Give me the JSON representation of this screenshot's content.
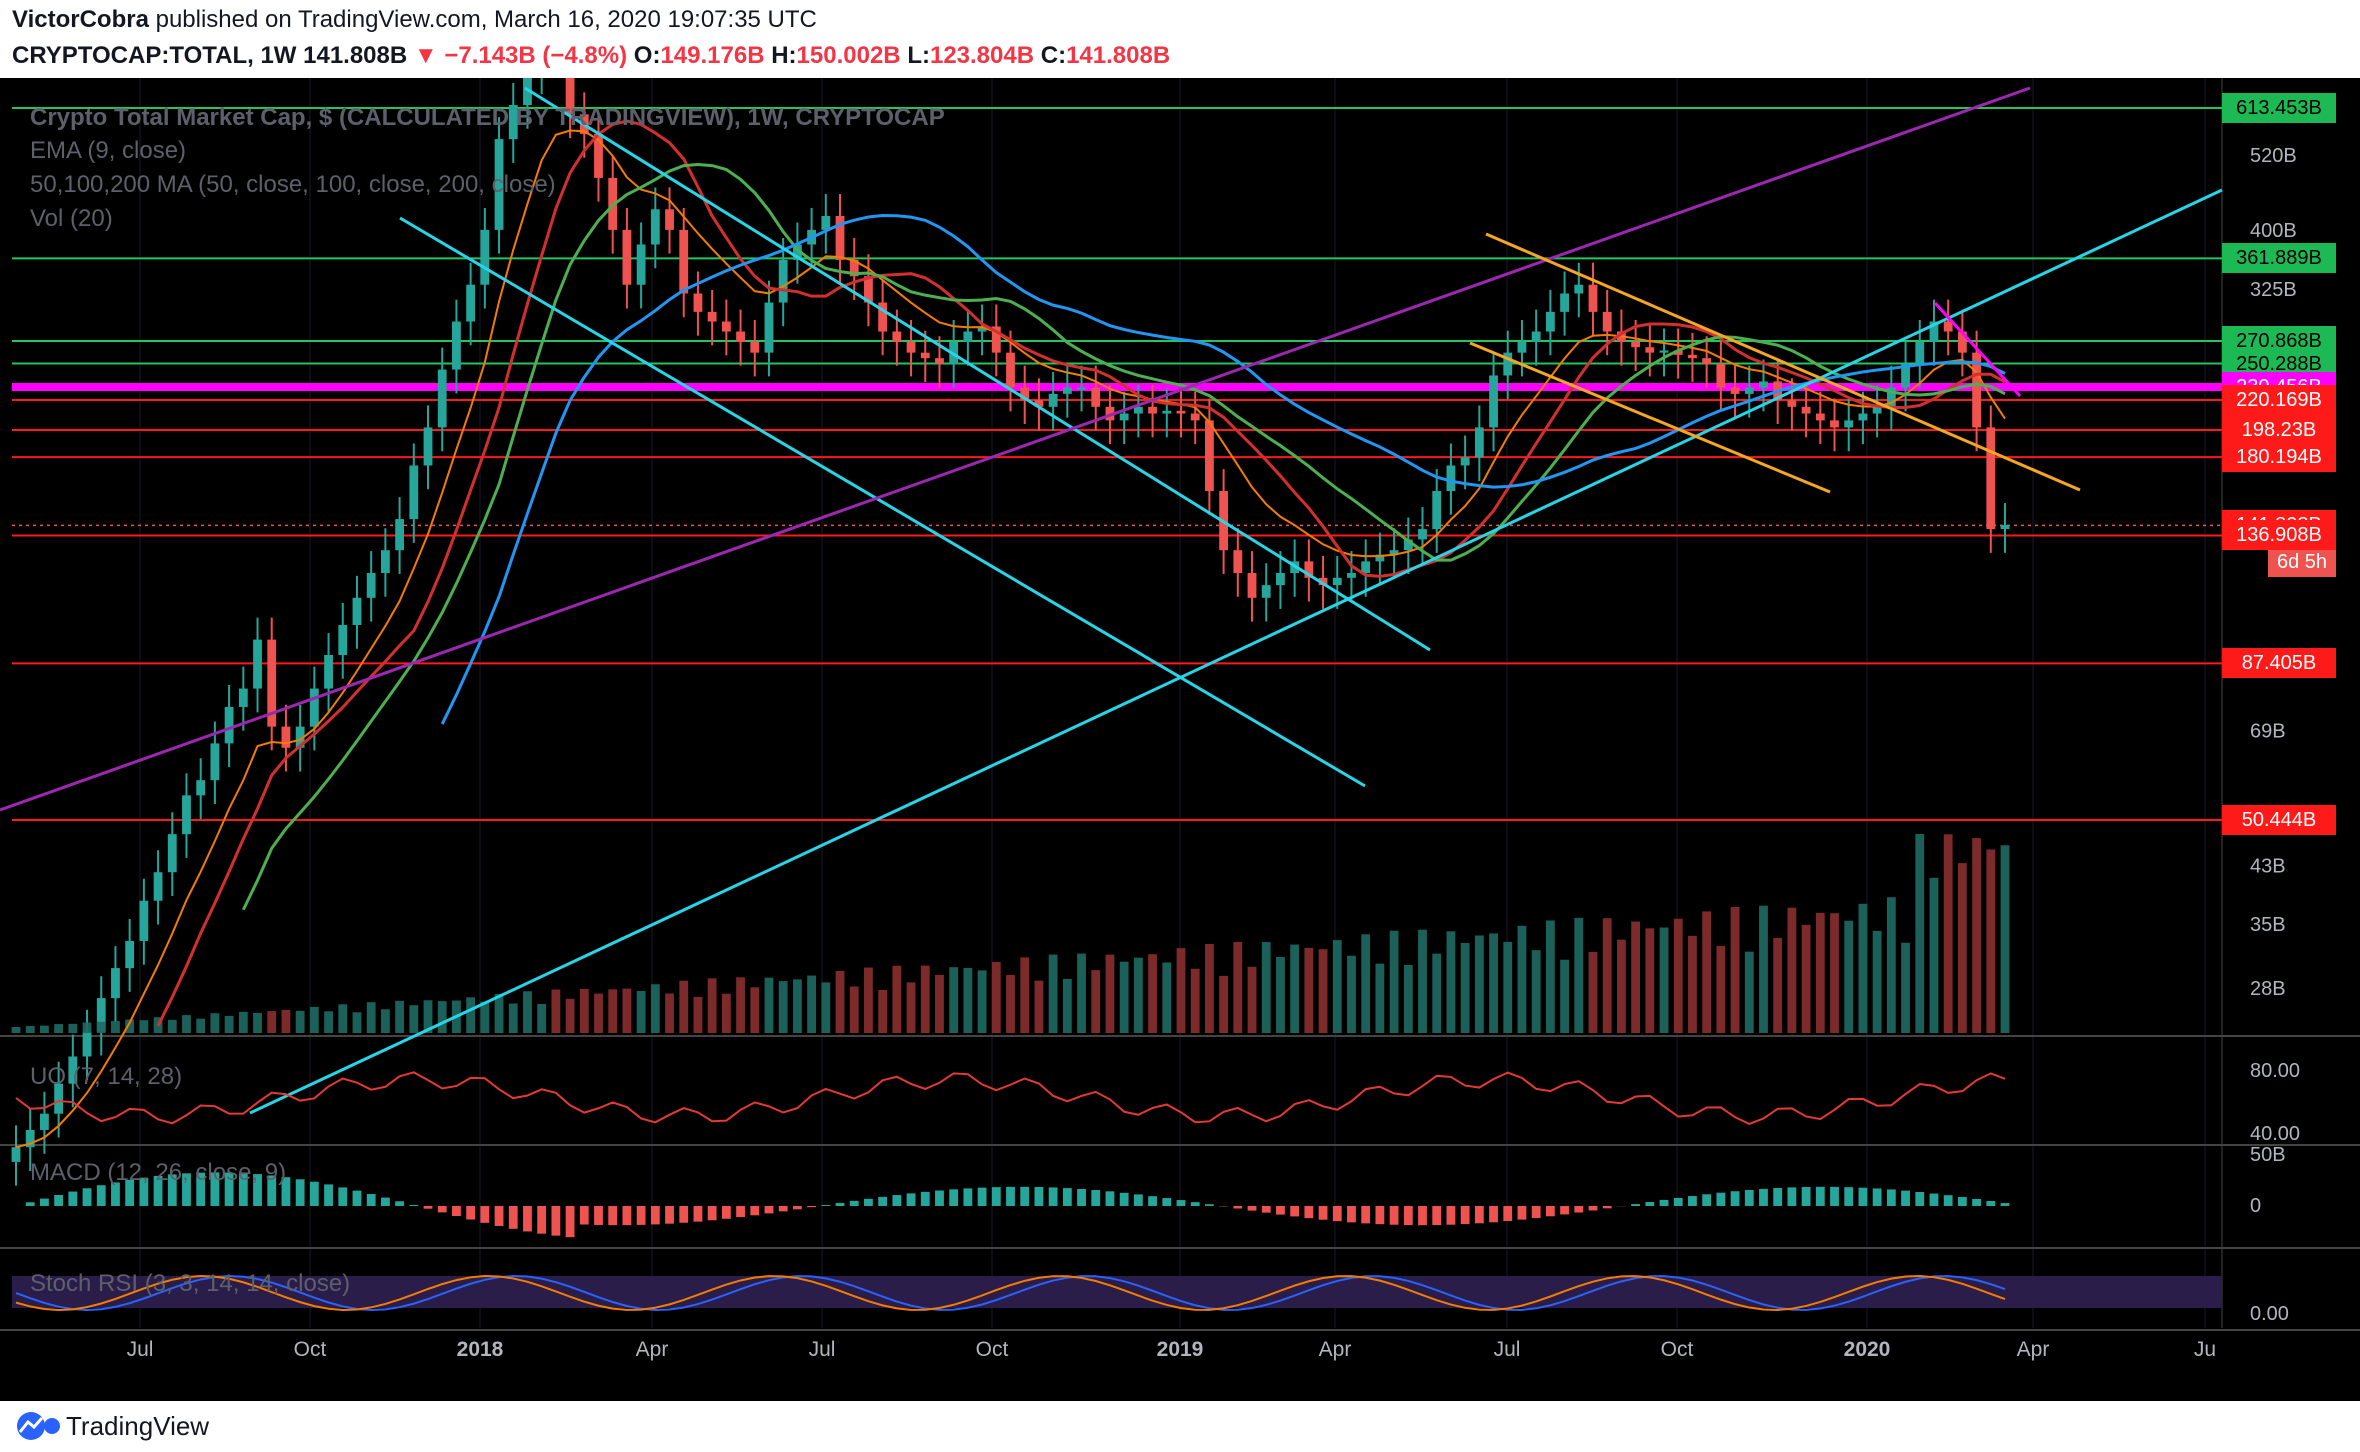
{
  "header": {
    "author": "VictorCobra",
    "published": "published on TradingView.com, March 16, 2020 19:07:35 UTC",
    "symbol": "CRYPTOCAP:TOTAL, 1W",
    "last": "141.808B",
    "change": "−7.143B (−4.8%)",
    "o_label": "O:",
    "o_value": "149.176B",
    "h_label": "H:",
    "h_value": "150.002B",
    "l_label": "L:",
    "l_value": "123.804B",
    "c_label": "C:",
    "c_value": "141.808B"
  },
  "legend": {
    "title": "Crypto Total Market Cap, $ (CALCULATED BY TRADINGVIEW), 1W, CRYPTOCAP",
    "ema": "EMA (9, close)",
    "ma": "50,100,200 MA (50, close, 100, close, 200, close)",
    "vol": "Vol (20)",
    "uo": "UO (7, 14, 28)",
    "macd": "MACD (12, 26, close, 9)",
    "stoch": "Stoch RSI (3, 3, 14, 14, close)"
  },
  "footer": {
    "brand": "TradingView"
  },
  "colors": {
    "bull": "#26a69a",
    "bear": "#ef5350",
    "green_level": "#22c55e",
    "red_level": "#ff1a1a",
    "magenta": "#ff00ff",
    "cyan": "#26d6e8",
    "orange": "#f5a623",
    "purple": "#9c27b0",
    "ema": "#f57c00",
    "ma50": "#4caf50",
    "ma100": "#d32f2f",
    "ma200": "#2196f3"
  },
  "chart_data": [
    {
      "type": "candlestick",
      "title": "Crypto Total Market Cap, $ (CALCULATED BY TRADINGVIEW), 1W, CRYPTOCAP",
      "y_scale": "log",
      "x_ticks": [
        "Jul",
        "Oct",
        "2018",
        "Apr",
        "Jul",
        "Oct",
        "2019",
        "Apr",
        "Jul",
        "Oct",
        "2020",
        "Apr",
        "Ju"
      ],
      "y_ticks": [
        "520B",
        "400B",
        "325B",
        "69B",
        "43B",
        "35B",
        "28B"
      ],
      "price_labels": [
        {
          "text": "613.453B",
          "value": 613.453,
          "kind": "green"
        },
        {
          "text": "361.889B",
          "value": 361.889,
          "kind": "green"
        },
        {
          "text": "270.868B",
          "value": 270.868,
          "kind": "green"
        },
        {
          "text": "250.288B",
          "value": 250.288,
          "kind": "green"
        },
        {
          "text": "230.456B",
          "value": 230.456,
          "kind": "magenta"
        },
        {
          "text": "220.169B",
          "value": 220.169,
          "kind": "red"
        },
        {
          "text": "198.23B",
          "value": 198.23,
          "kind": "red"
        },
        {
          "text": "180.194B",
          "value": 180.194,
          "kind": "red"
        },
        {
          "text": "141.808B",
          "value": 141.808,
          "kind": "last"
        },
        {
          "text": "6d 5h",
          "value": null,
          "kind": "countdown"
        },
        {
          "text": "136.908B",
          "value": 136.908,
          "kind": "red"
        },
        {
          "text": "87.405B",
          "value": 87.405,
          "kind": "red"
        },
        {
          "text": "50.444B",
          "value": 50.444,
          "kind": "red"
        }
      ],
      "series_close": [
        16,
        17,
        18,
        20,
        22,
        24,
        27,
        30,
        33,
        38,
        42,
        48,
        55,
        58,
        66,
        75,
        80,
        95,
        70,
        65,
        70,
        80,
        90,
        100,
        110,
        120,
        130,
        145,
        175,
        200,
        245,
        290,
        330,
        400,
        550,
        620,
        700,
        800,
        750,
        600,
        560,
        480,
        400,
        330,
        380,
        430,
        400,
        320,
        300,
        290,
        280,
        270,
        260,
        310,
        360,
        380,
        400,
        420,
        360,
        340,
        310,
        280,
        270,
        260,
        255,
        250,
        270,
        280,
        285,
        260,
        230,
        220,
        215,
        225,
        230,
        230,
        215,
        205,
        210,
        215,
        210,
        212,
        210,
        205,
        160,
        130,
        120,
        110,
        115,
        120,
        125,
        118,
        115,
        118,
        120,
        125,
        128,
        130,
        135,
        140,
        160,
        175,
        180,
        200,
        240,
        260,
        270,
        280,
        300,
        320,
        330,
        300,
        280,
        270,
        265,
        260,
        262,
        258,
        255,
        250,
        230,
        225,
        230,
        235,
        220,
        215,
        210,
        205,
        200,
        205,
        210,
        215,
        230,
        250,
        270,
        290,
        280,
        260,
        200,
        140,
        142
      ]
    },
    {
      "type": "line",
      "title": "UO (7, 14, 28)",
      "y_ticks": [
        "80.00",
        "40.00"
      ],
      "ylim": [
        35,
        90
      ]
    },
    {
      "type": "bar",
      "title": "MACD (12, 26, close, 9)",
      "y_ticks": [
        "50B",
        "0"
      ]
    },
    {
      "type": "line",
      "title": "Stoch RSI (3, 3, 14, 14, close)",
      "y_ticks": [
        "0.00"
      ]
    }
  ]
}
